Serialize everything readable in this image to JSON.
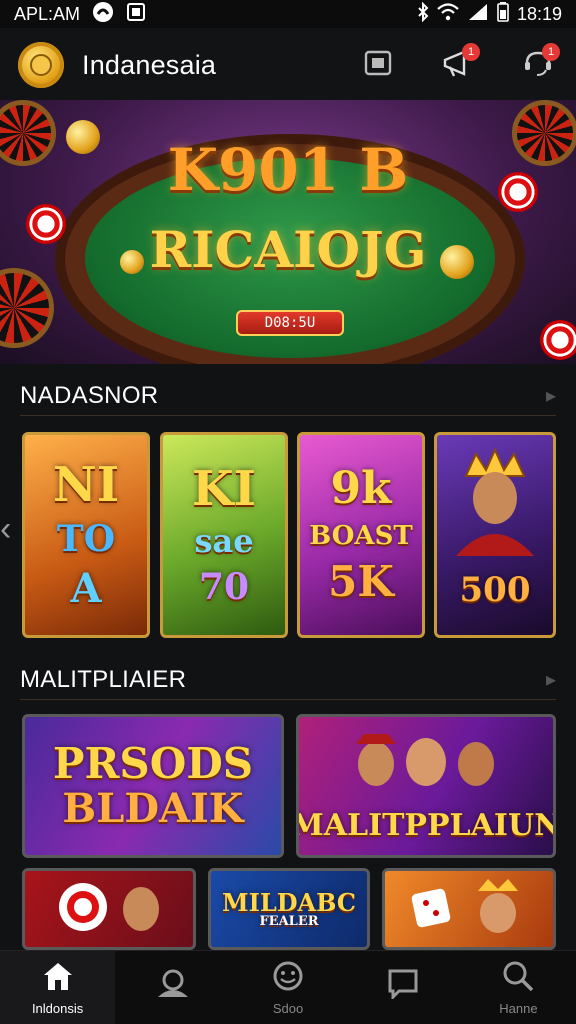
{
  "status_bar": {
    "time_left": "APL:AM",
    "time_right": "18:19",
    "left_icons": [
      "app-circle-icon",
      "photo-icon"
    ],
    "right_icons": [
      "bluetooth-icon",
      "wifi-icon",
      "signal-icon",
      "battery-icon"
    ]
  },
  "header": {
    "title": "Indanesaia",
    "logo_icon": "gold-gear-logo-icon",
    "actions": [
      {
        "icon": "wallet-icon",
        "badge": ""
      },
      {
        "icon": "megaphone-icon",
        "badge": "1"
      },
      {
        "icon": "support-chat-icon",
        "badge": "1"
      }
    ]
  },
  "hero": {
    "title_line1": "K901 B",
    "title_line2": "RICAIOJG",
    "button_label": "D08:5U"
  },
  "section1": {
    "title": "NADASNOR",
    "cards": [
      {
        "lines": [
          "NI",
          "TO",
          "A"
        ],
        "theme": "orange"
      },
      {
        "lines": [
          "KI",
          "sae",
          "70"
        ],
        "theme": "green"
      },
      {
        "lines": [
          "9k",
          "BOAST",
          "5K"
        ],
        "theme": "purple"
      },
      {
        "lines": [
          "500"
        ],
        "theme": "king"
      }
    ]
  },
  "section2": {
    "title": "MALITPLIAIER",
    "cards_row1": [
      {
        "lines": [
          "PRSODS",
          "BLDAIK"
        ],
        "theme": "purple-blue"
      },
      {
        "lines": [
          "MALITPPLAIUN"
        ],
        "theme": "red-purple"
      }
    ],
    "cards_row2": [
      {
        "lines": [
          ""
        ],
        "theme": "red"
      },
      {
        "lines": [
          "MILDABC",
          "FEALER"
        ],
        "theme": "blue"
      },
      {
        "lines": [
          ""
        ],
        "theme": "orange"
      }
    ]
  },
  "bottom_nav": [
    {
      "label": "Inldonsis",
      "icon": "home-icon",
      "active": true
    },
    {
      "label": "",
      "icon": "profile-icon",
      "active": false
    },
    {
      "label": "Sdoo",
      "icon": "emoji-icon",
      "active": false
    },
    {
      "label": "",
      "icon": "chat-icon",
      "active": false
    },
    {
      "label": "Hanne",
      "icon": "search-icon",
      "active": false
    }
  ],
  "colors": {
    "background": "#111214",
    "accent_gold": "#ffd24a",
    "badge_red": "#e53935"
  }
}
